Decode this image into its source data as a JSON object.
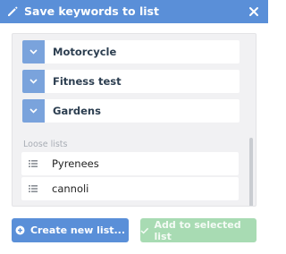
{
  "dialog": {
    "title": "Save keywords to list",
    "header_color": "#5a8fd8"
  },
  "icons": {
    "header_left": "pencil-icon",
    "header_right": "close-icon",
    "group_toggle": "chevron-down-icon",
    "loose_item": "list-icon",
    "create": "plus-circle-icon",
    "add": "checkmark-icon"
  },
  "grouped_lists": [
    {
      "label": "Motorcycle"
    },
    {
      "label": "Fitness test"
    },
    {
      "label": "Gardens"
    }
  ],
  "loose_section": {
    "label": "Loose lists",
    "items": [
      {
        "label": "Pyrenees"
      },
      {
        "label": "cannoli"
      }
    ]
  },
  "footer": {
    "create_label": "Create new list...",
    "add_label": "Add to selected list"
  },
  "colors": {
    "accent": "#5a8fd8",
    "toggle": "#7aa3dc",
    "add_disabled": "#a8dbb3"
  }
}
